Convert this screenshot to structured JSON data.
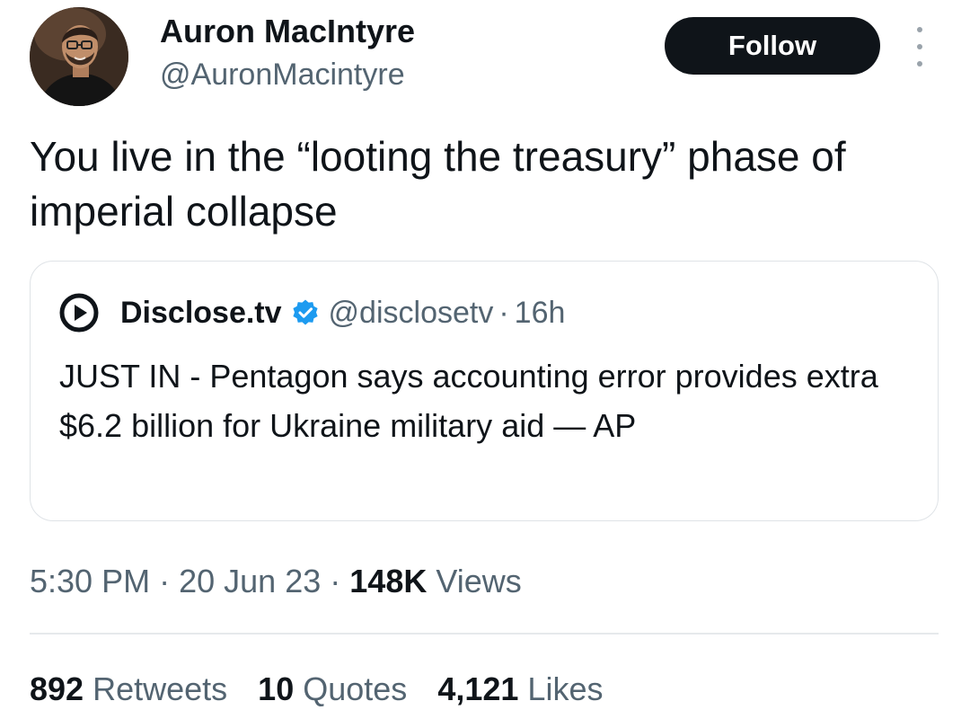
{
  "author": {
    "display_name": "Auron MacIntyre",
    "handle": "@AuronMacintyre",
    "avatar_icon": "user-avatar"
  },
  "follow_button": {
    "label": "Follow",
    "bg_color": "#0f1419",
    "text_color": "#ffffff"
  },
  "more_menu_icon": "more-vertical-icon",
  "tweet": {
    "text": "You live in the “looting the treasury” phase of imperial collapse"
  },
  "quoted_tweet": {
    "logo_icon": "play-logo-icon",
    "name": "Disclose.tv",
    "verified_icon": "verified-badge-icon",
    "verified_color": "#1d9bf0",
    "handle": "@disclosetv",
    "separator": "·",
    "time": "16h",
    "text": "JUST IN - Pentagon says accounting error provides extra $6.2 billion for Ukraine military aid — AP"
  },
  "meta": {
    "time": "5:30 PM",
    "sep1": "·",
    "date": "20 Jun 23",
    "sep2": "·",
    "views_count": "148K",
    "views_label": "Views"
  },
  "stats": {
    "retweets_count": "892",
    "retweets_label": "Retweets",
    "quotes_count": "10",
    "quotes_label": "Quotes",
    "likes_count": "4,121",
    "likes_label": "Likes"
  }
}
